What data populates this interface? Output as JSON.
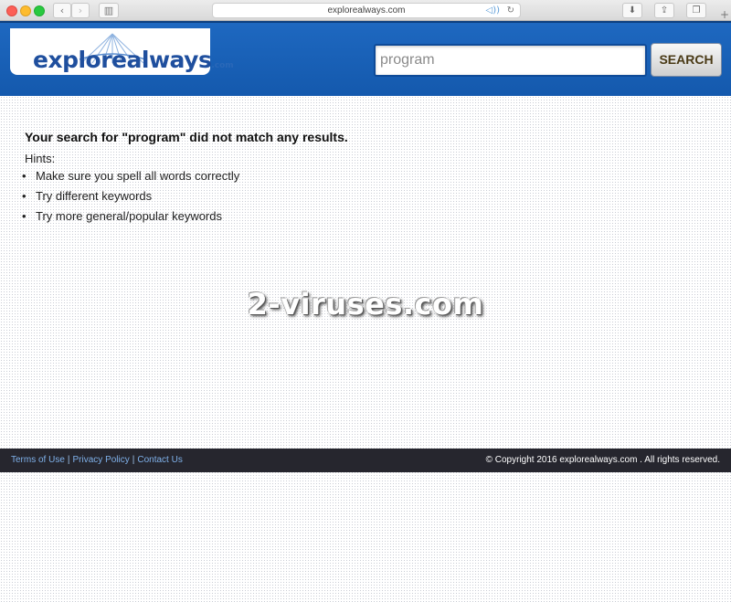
{
  "browser": {
    "url": "explorealways.com",
    "back_icon": "‹",
    "forward_icon": "›",
    "sidebar_icon": "▥",
    "audio_icon": "◁))",
    "reload_icon": "↻",
    "download_icon": "⬇",
    "share_icon": "⇪",
    "tabs_icon": "❐",
    "newtab_icon": "+"
  },
  "header": {
    "logo_main": "explorealways",
    "logo_tld": ".com",
    "search_value": "program",
    "search_button": "SEARCH",
    "colors": {
      "header_bg": "#1a62b8",
      "logo_text": "#1f4f9e"
    }
  },
  "content": {
    "result_title": "Your search for \"program\" did not match any results.",
    "hints_label": "Hints:",
    "hints": [
      "Make sure you spell all words correctly",
      "Try different keywords",
      "Try more general/popular keywords"
    ],
    "bullet": "•"
  },
  "watermark": "2-viruses.com",
  "footer": {
    "links": [
      "Terms of Use",
      "Privacy Policy",
      "Contact Us"
    ],
    "separator": "|",
    "copyright": "© Copyright 2016 explorealways.com . All rights reserved."
  }
}
